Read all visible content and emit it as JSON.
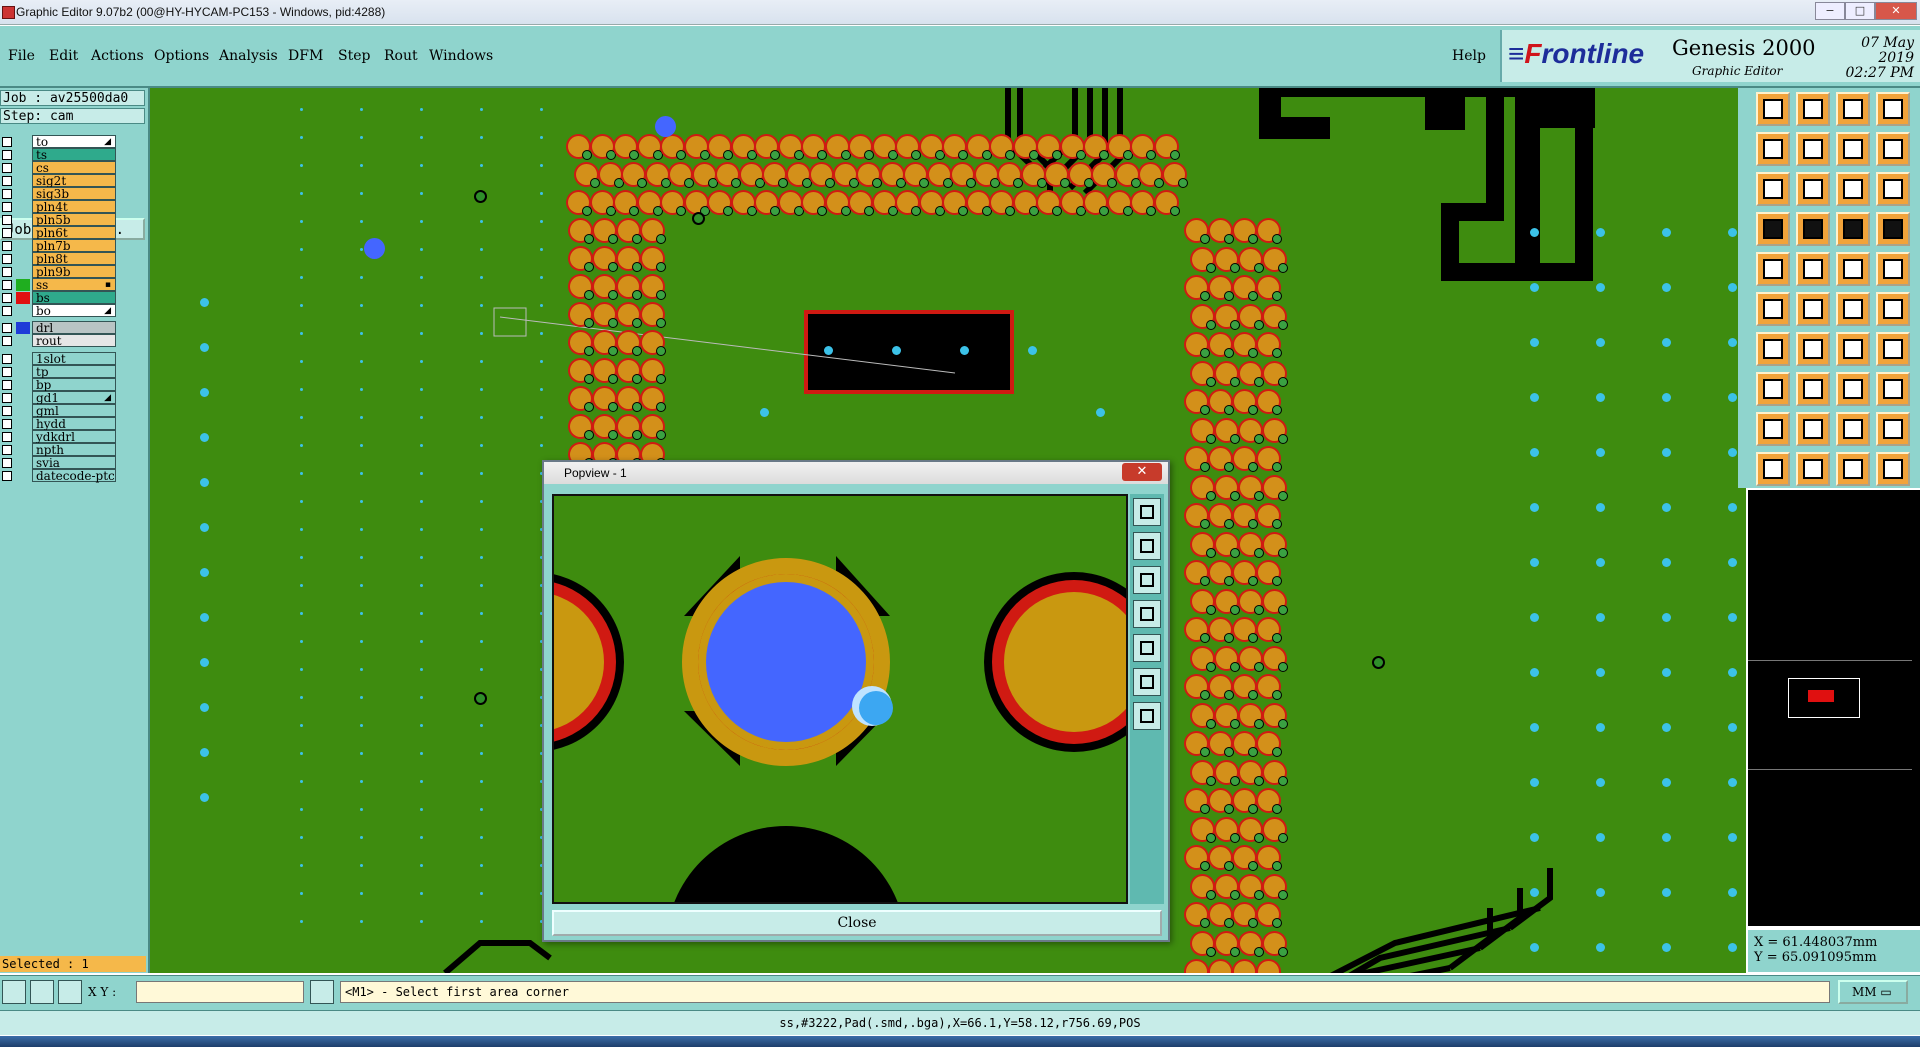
{
  "window": {
    "title": "Graphic Editor 9.07b2 (00@HY-HYCAM-PC153 - Windows, pid:4288)",
    "controls": [
      "−",
      "□",
      "✕"
    ]
  },
  "menu": {
    "items": [
      "File",
      "Edit",
      "Actions",
      "Options",
      "Analysis",
      "DFM",
      "Step",
      "Rout",
      "Windows"
    ],
    "help": "Help"
  },
  "brand": {
    "logo_mark": "F",
    "logo_text": "rontline",
    "product": "Genesis 2000",
    "subtitle": "Graphic Editor",
    "date": "07 May 2019",
    "time": "02:27 PM"
  },
  "job": {
    "job_label": "Job : av25500da0",
    "step_label": "Step: cam",
    "matrix_button": "Job Matrix ..."
  },
  "layers": [
    {
      "name": "to",
      "color": "#ffffff",
      "arrow": "◢"
    },
    {
      "name": "ts",
      "color": "#2faa8c"
    },
    {
      "name": "cs",
      "color": "#f5b84a"
    },
    {
      "name": "sig2t",
      "color": "#f5b84a"
    },
    {
      "name": "sig3b",
      "color": "#f5b84a"
    },
    {
      "name": "pln4t",
      "color": "#f5b84a"
    },
    {
      "name": "pln5b",
      "color": "#f5b84a"
    },
    {
      "name": "pln6t",
      "color": "#f5b84a"
    },
    {
      "name": "pln7b",
      "color": "#f5b84a"
    },
    {
      "name": "pln8t",
      "color": "#f5b84a"
    },
    {
      "name": "pln9b",
      "color": "#f5b84a"
    },
    {
      "name": "ss",
      "color": "#f5b84a",
      "arrow": "▪",
      "sw": "#1fae1f"
    },
    {
      "name": "bs",
      "color": "#2faa8c",
      "sw": "#e01010"
    },
    {
      "name": "bo",
      "color": "#ffffff",
      "arrow": "◢"
    }
  ],
  "drill_layers": [
    {
      "name": "drl",
      "color": "#b9c4c4",
      "sw": "#1e3cd8"
    },
    {
      "name": "rout",
      "color": "#e6e6e6"
    }
  ],
  "misc_layers": [
    {
      "name": "1slot"
    },
    {
      "name": "tp"
    },
    {
      "name": "bp"
    },
    {
      "name": "gd1",
      "arrow": "◢"
    },
    {
      "name": "gml"
    },
    {
      "name": "hydd"
    },
    {
      "name": "ydkdrl"
    },
    {
      "name": "npth"
    },
    {
      "name": "svia"
    },
    {
      "name": "datecode-ptc"
    }
  ],
  "selected": "Selected : 1",
  "popview": {
    "title": "Popview - 1",
    "close_button": "Close"
  },
  "coords": {
    "x": "X =  61.448037mm",
    "y": "Y =  65.091095mm"
  },
  "cmdbar": {
    "xy_label": "X Y :",
    "xy_value": "",
    "prompt": "<M1> - Select first area corner",
    "unit": "MM"
  },
  "status": "ss,#3222,Pad(.smd,.bga),X=66.1,Y=58.12,r756.69,POS"
}
